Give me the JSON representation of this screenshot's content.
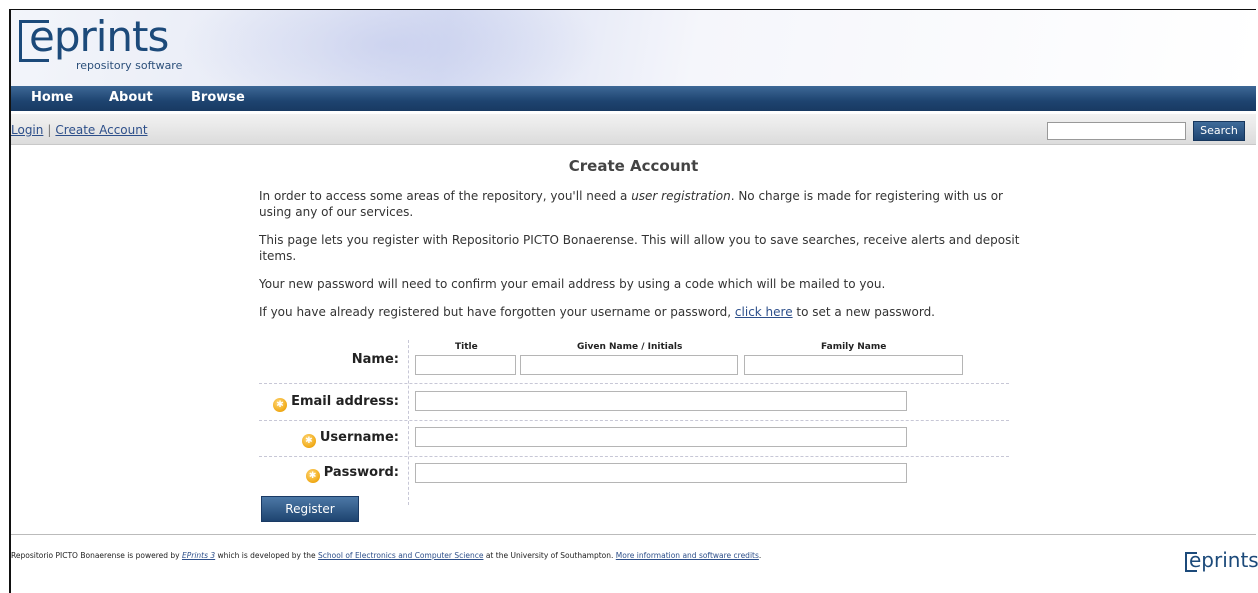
{
  "logo": {
    "name": "eprints",
    "tagline": "repository software"
  },
  "nav": {
    "items": [
      "Home",
      "About",
      "Browse"
    ]
  },
  "subbar": {
    "login": "Login",
    "sep": "|",
    "create_account": "Create Account",
    "search_placeholder": "",
    "search_button": "Search"
  },
  "page": {
    "title": "Create Account",
    "p1_pre": "In order to access some areas of the repository, you'll need a ",
    "p1_em": "user registration",
    "p1_post": ". No charge is made for registering with us or using any of our services.",
    "p2": "This page lets you register with Repositorio PICTO Bonaerense. This will allow you to save searches, receive alerts and deposit items.",
    "p3": "Your new password will need to confirm your email address by using a code which will be mailed to you.",
    "p4_pre": "If you have already registered but have forgotten your username or password, ",
    "p4_link": "click here",
    "p4_post": " to set a new password."
  },
  "form": {
    "name_label": "Name:",
    "col_title": "Title",
    "col_given": "Given Name / Initials",
    "col_family": "Family Name",
    "email_label": "Email address:",
    "username_label": "Username:",
    "password_label": "Password:",
    "register_button": "Register",
    "required_icon": "required-star-icon"
  },
  "footer": {
    "pre": "Repositorio PICTO Bonaerense is powered by ",
    "eprints_link": "EPrints 3",
    "mid1": " which is developed by the ",
    "school_link": "School of Electronics and Computer Science",
    "mid2": " at the University of Southampton. ",
    "more_link": "More information and software credits",
    "end": ".",
    "logo": "eprints"
  }
}
